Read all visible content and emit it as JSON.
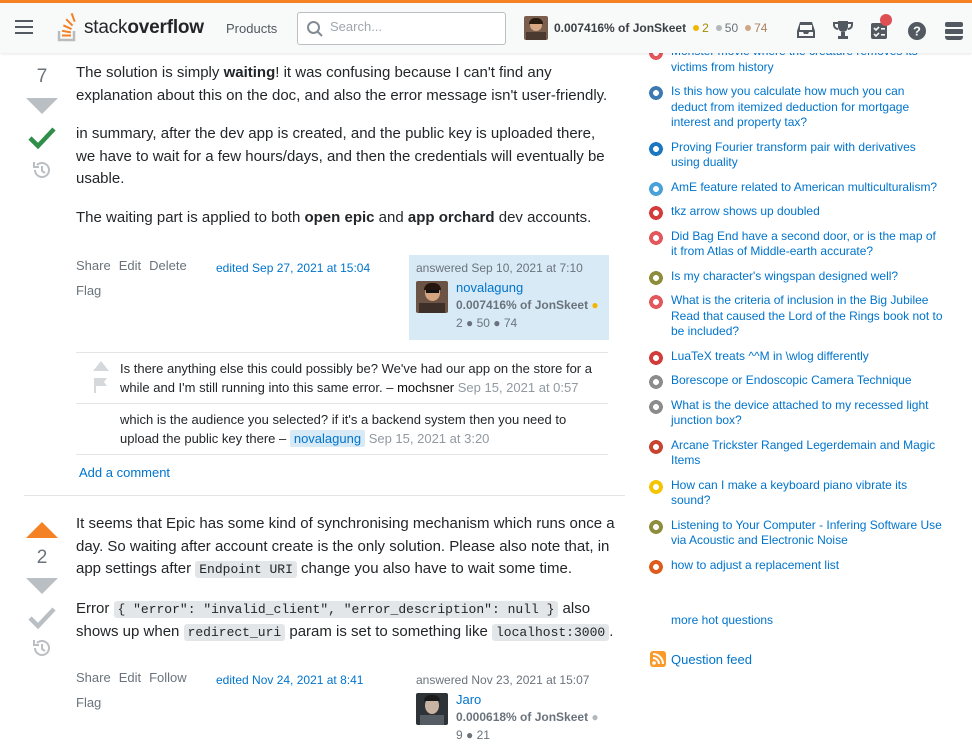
{
  "topbar": {
    "logo_light": "stack",
    "logo_bold": "overflow",
    "products": "Products",
    "search_placeholder": "Search...",
    "user_rep": "0.007416% of JonSkeet",
    "gold": "2",
    "silver": "50",
    "bronze": "74"
  },
  "answer1": {
    "votes": "7",
    "p1_a": "The solution is simply ",
    "p1_b": "waiting",
    "p1_c": "! it was confusing because I can't find any explanation about this on the doc, and also the error message isn't user-friendly.",
    "p2": "in summary, after the dev app is created, and the public key is uploaded there, we have to wait for a few hours/days, and then the credentials will eventually be usable.",
    "p3_a": "The waiting part is applied to both ",
    "p3_b": "open epic",
    "p3_c": " and ",
    "p3_d": "app orchard",
    "p3_e": " dev accounts.",
    "menu": [
      "Share",
      "Edit",
      "Delete",
      "Flag"
    ],
    "edited": "edited Sep 27, 2021 at 15:04",
    "answered": "answered Sep 10, 2021 at 7:10",
    "user": "novalagung",
    "user_rep": "0.007416% of JonSkeet",
    "badges": "2 ● 50 ● 74",
    "comments": [
      {
        "text": "Is there anything else this could possibly be? We've had our app on the store for a while and I'm still running into this same error. – ",
        "author": "mochsner",
        "date": " Sep 15, 2021 at 0:57"
      },
      {
        "text": "which is the audience you selected? if it's a backend system then you need to upload the public key there – ",
        "author": "novalagung",
        "date": " Sep 15, 2021 at 3:20"
      }
    ],
    "add_comment": "Add a comment"
  },
  "answer2": {
    "votes": "2",
    "p1_a": "It seems that Epic has some kind of synchronising mechanism which runs once a day. So waiting after account create is the only solution. Please also note that, in app settings after ",
    "p1_code": "Endpoint URI",
    "p1_c": " change you also have to wait some time.",
    "p2_a": "Error ",
    "p2_code1": "{ \"error\": \"invalid_client\", \"error_description\": null }",
    "p2_b": " also shows up when ",
    "p2_code2": "redirect_uri",
    "p2_c": " param is set to something like ",
    "p2_code3": "localhost:3000",
    "p2_d": ".",
    "menu": [
      "Share",
      "Edit",
      "Follow",
      "Flag"
    ],
    "edited": "edited Nov 24, 2021 at 8:41",
    "answered": "answered Nov 23, 2021 at 15:07",
    "user": "Jaro",
    "user_rep": "0.000618% of JonSkeet",
    "badges": "9 ● 21"
  },
  "sidebar": {
    "hot": [
      {
        "title": "Monster movie where the creature removes its victims from history",
        "icon": "scifi-icon",
        "color": "#e4575c"
      },
      {
        "title": "Is this how you calculate how much you can deduct from itemized deduction for mortgage interest and property tax?",
        "icon": "money-icon",
        "color": "#3d7ab3"
      },
      {
        "title": "Proving Fourier transform pair with derivatives using duality",
        "icon": "signal-icon",
        "color": "#1a78c2"
      },
      {
        "title": "AmE feature related to American multiculturalism?",
        "icon": "ell-icon",
        "color": "#48a1d8"
      },
      {
        "title": "tkz arrow shows up doubled",
        "icon": "tex-icon",
        "color": "#d43b3b"
      },
      {
        "title": "Did Bag End have a second door, or is the map of it from Atlas of Middle-earth accurate?",
        "icon": "scifi-icon",
        "color": "#e4575c"
      },
      {
        "title": "Is my character's wingspan designed well?",
        "icon": "worldbuilding-icon",
        "color": "#8d8d3b"
      },
      {
        "title": "What is the criteria of inclusion in the Big Jubilee Read that caused the Lord of the Rings book not to be included?",
        "icon": "scifi-icon",
        "color": "#e4575c"
      },
      {
        "title": "LuaTeX treats ^^M in \\wlog differently",
        "icon": "tex-icon",
        "color": "#d43b3b"
      },
      {
        "title": "Borescope or Endoscopic Camera Technique",
        "icon": "diy-icon",
        "color": "#8c8c8c"
      },
      {
        "title": "What is the device attached to my recessed light junction box?",
        "icon": "diy-icon",
        "color": "#8c8c8c"
      },
      {
        "title": "Arcane Trickster Ranged Legerdemain and Magic Items",
        "icon": "rpg-icon",
        "color": "#c8442f"
      },
      {
        "title": "How can I make a keyboard piano vibrate its sound?",
        "icon": "music-icon",
        "color": "#f5c400"
      },
      {
        "title": "Listening to Your Computer - Infering Software Use via Acoustic and Electronic Noise",
        "icon": "worldbuilding-icon",
        "color": "#8d8d3b"
      },
      {
        "title": "how to adjust a replacement list",
        "icon": "mathematica-icon",
        "color": "#e05a1b"
      }
    ],
    "more": "more hot questions",
    "feed": "Question feed"
  }
}
